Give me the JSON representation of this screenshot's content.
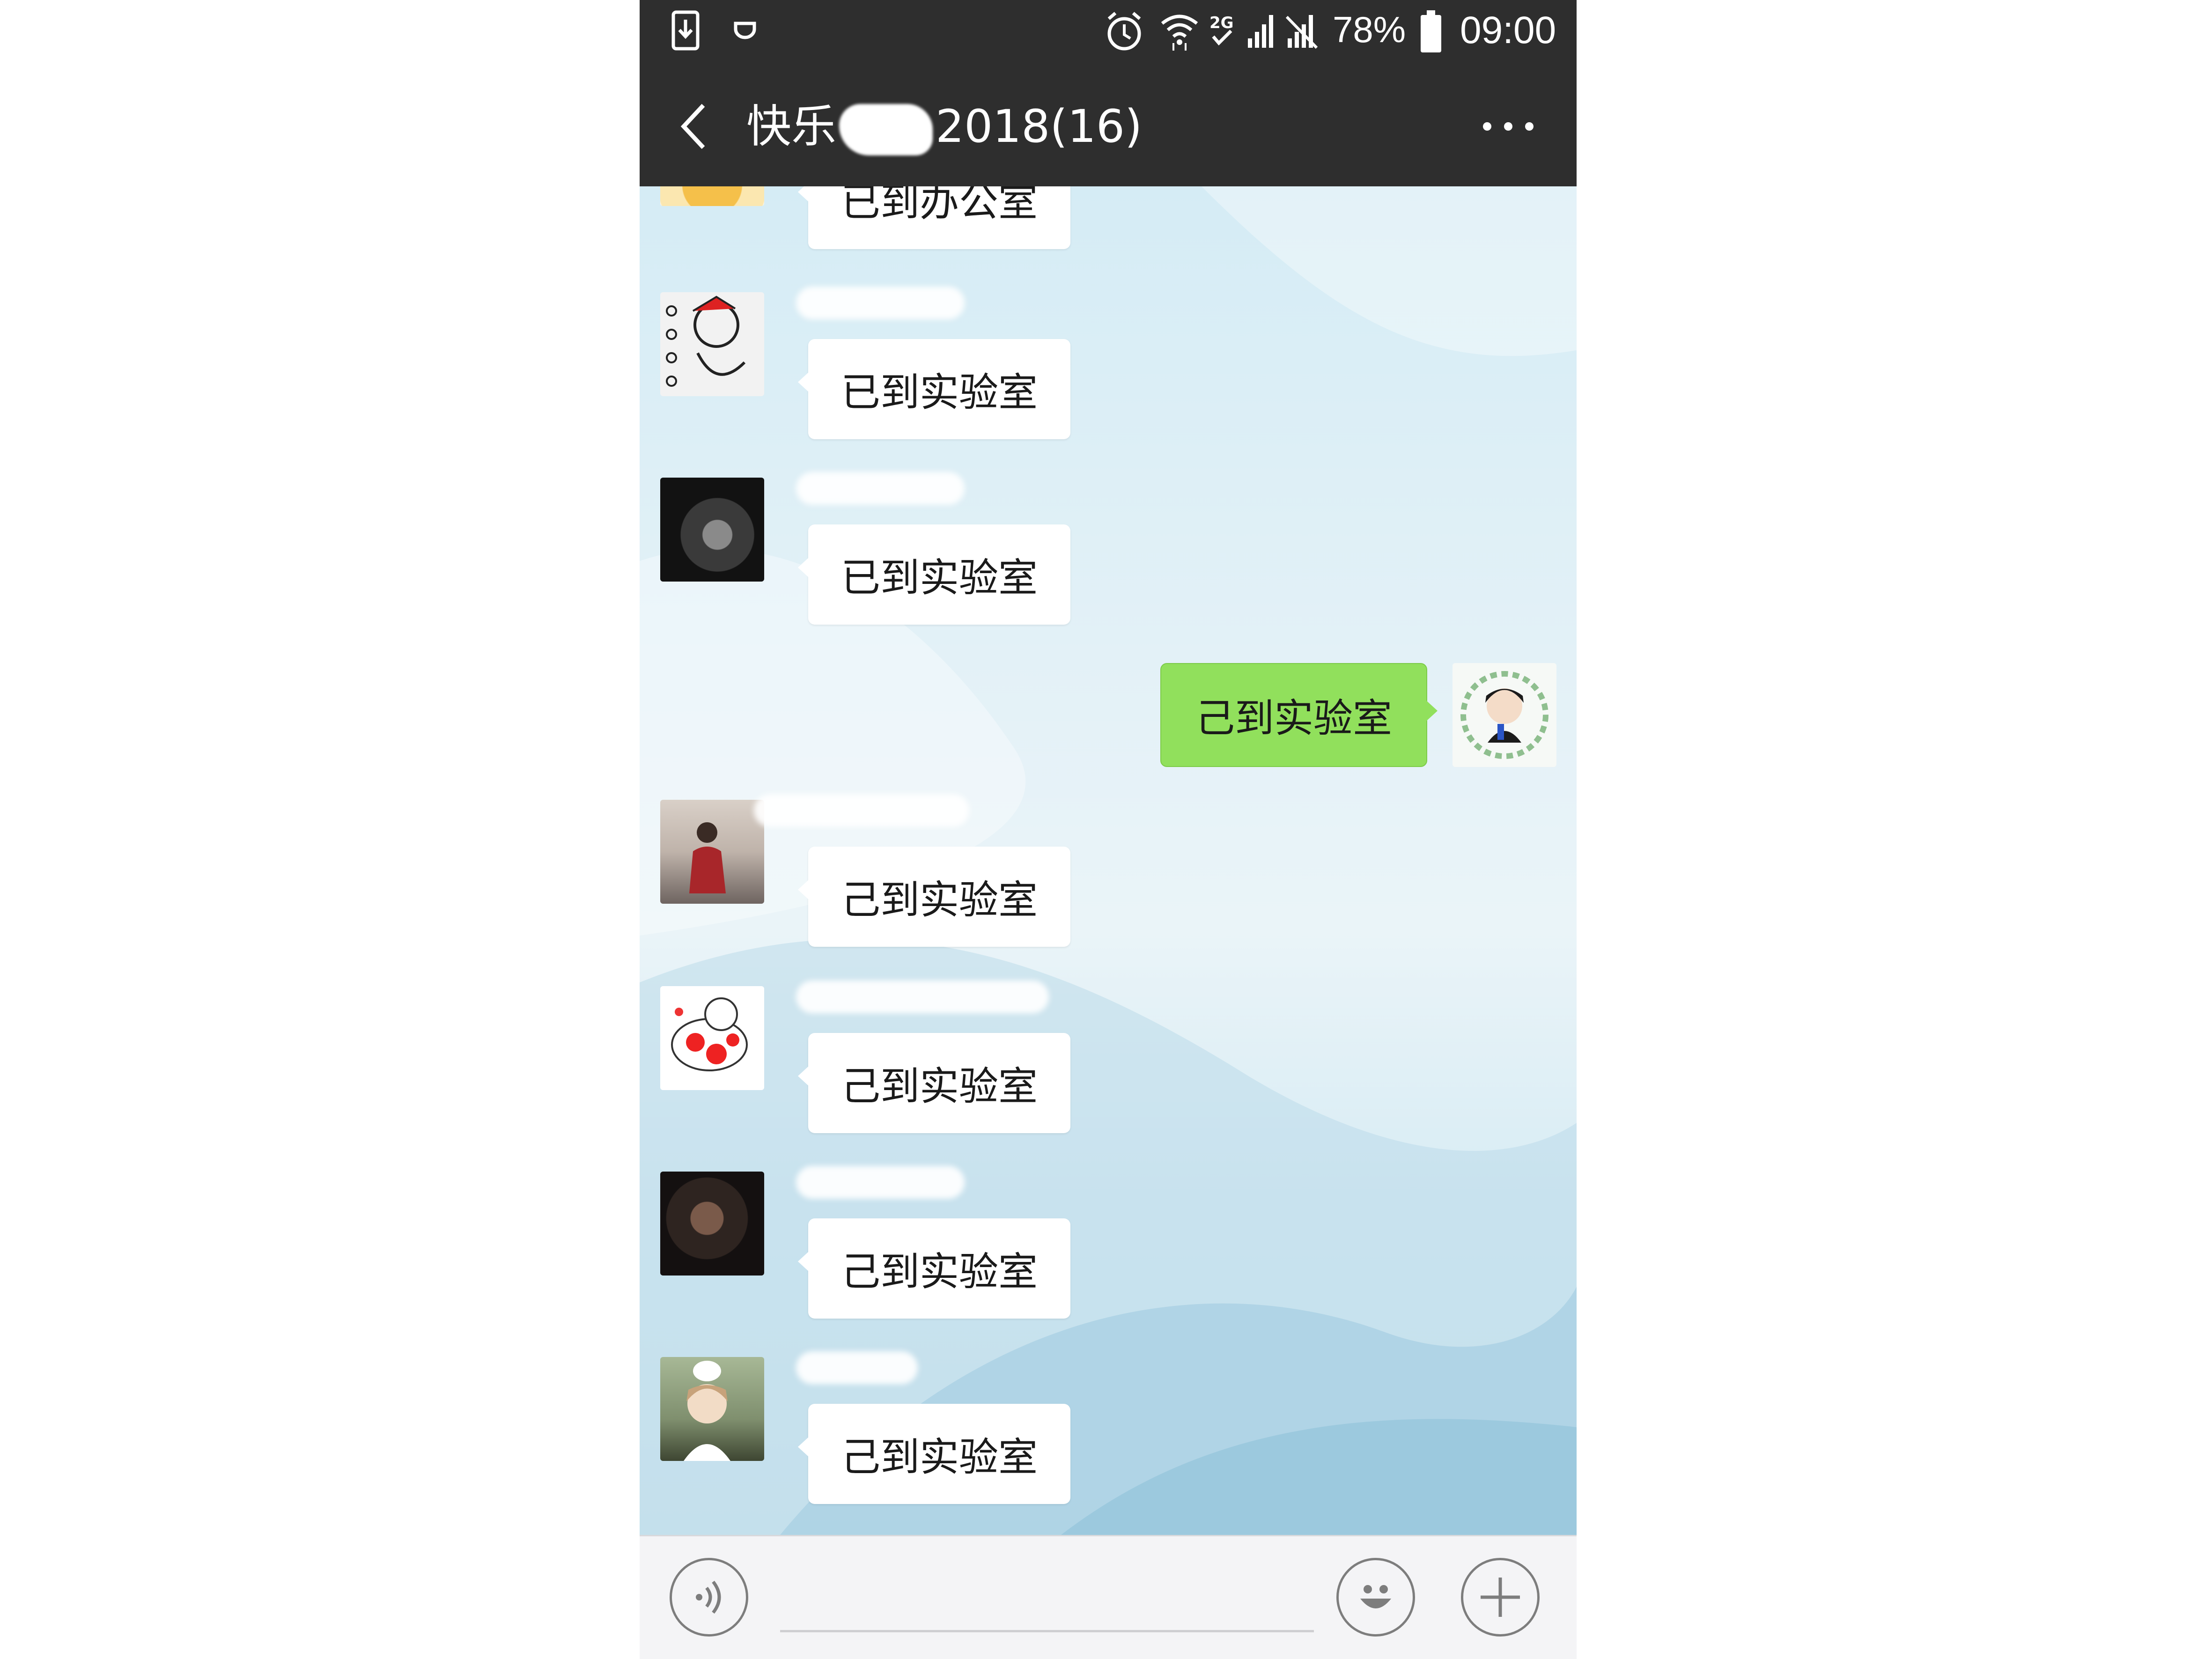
{
  "status_bar": {
    "battery_percent": "78%",
    "time": "09:00",
    "icons": [
      "download-icon",
      "notification-icon",
      "alarm-icon",
      "wifi-icon",
      "hd-icon",
      "signal-icon",
      "signal-no-service-icon",
      "battery-icon"
    ]
  },
  "chat_header": {
    "title_prefix": "快乐",
    "title_suffix": "2018(16)",
    "back_icon": "back-arrow-icon",
    "more_icon": "more-icon"
  },
  "messages": [
    {
      "side": "left",
      "text": "已到办公室",
      "avatar": "avatar-cartoon-yellow"
    },
    {
      "side": "left",
      "text": "已到实验室",
      "avatar": "avatar-sketch-character"
    },
    {
      "side": "left",
      "text": "已到实验室",
      "avatar": "avatar-dark-portrait"
    },
    {
      "side": "right",
      "text": "己到实验室",
      "avatar": "avatar-self-anime"
    },
    {
      "side": "left",
      "text": "己到实验室",
      "avatar": "avatar-woman-red-coat"
    },
    {
      "side": "left",
      "text": "己到实验室",
      "avatar": "avatar-koi-cartoon"
    },
    {
      "side": "left",
      "text": "己到实验室",
      "avatar": "avatar-woman-dark"
    },
    {
      "side": "left",
      "text": "己到实验室",
      "avatar": "avatar-anime-cat"
    }
  ],
  "input_bar": {
    "voice_icon": "voice-icon",
    "emoji_icon": "emoji-icon",
    "plus_icon": "plus-icon"
  },
  "colors": {
    "header_bg": "#2e2e2e",
    "sent_bubble": "#91e05c",
    "received_bubble": "#ffffff"
  }
}
